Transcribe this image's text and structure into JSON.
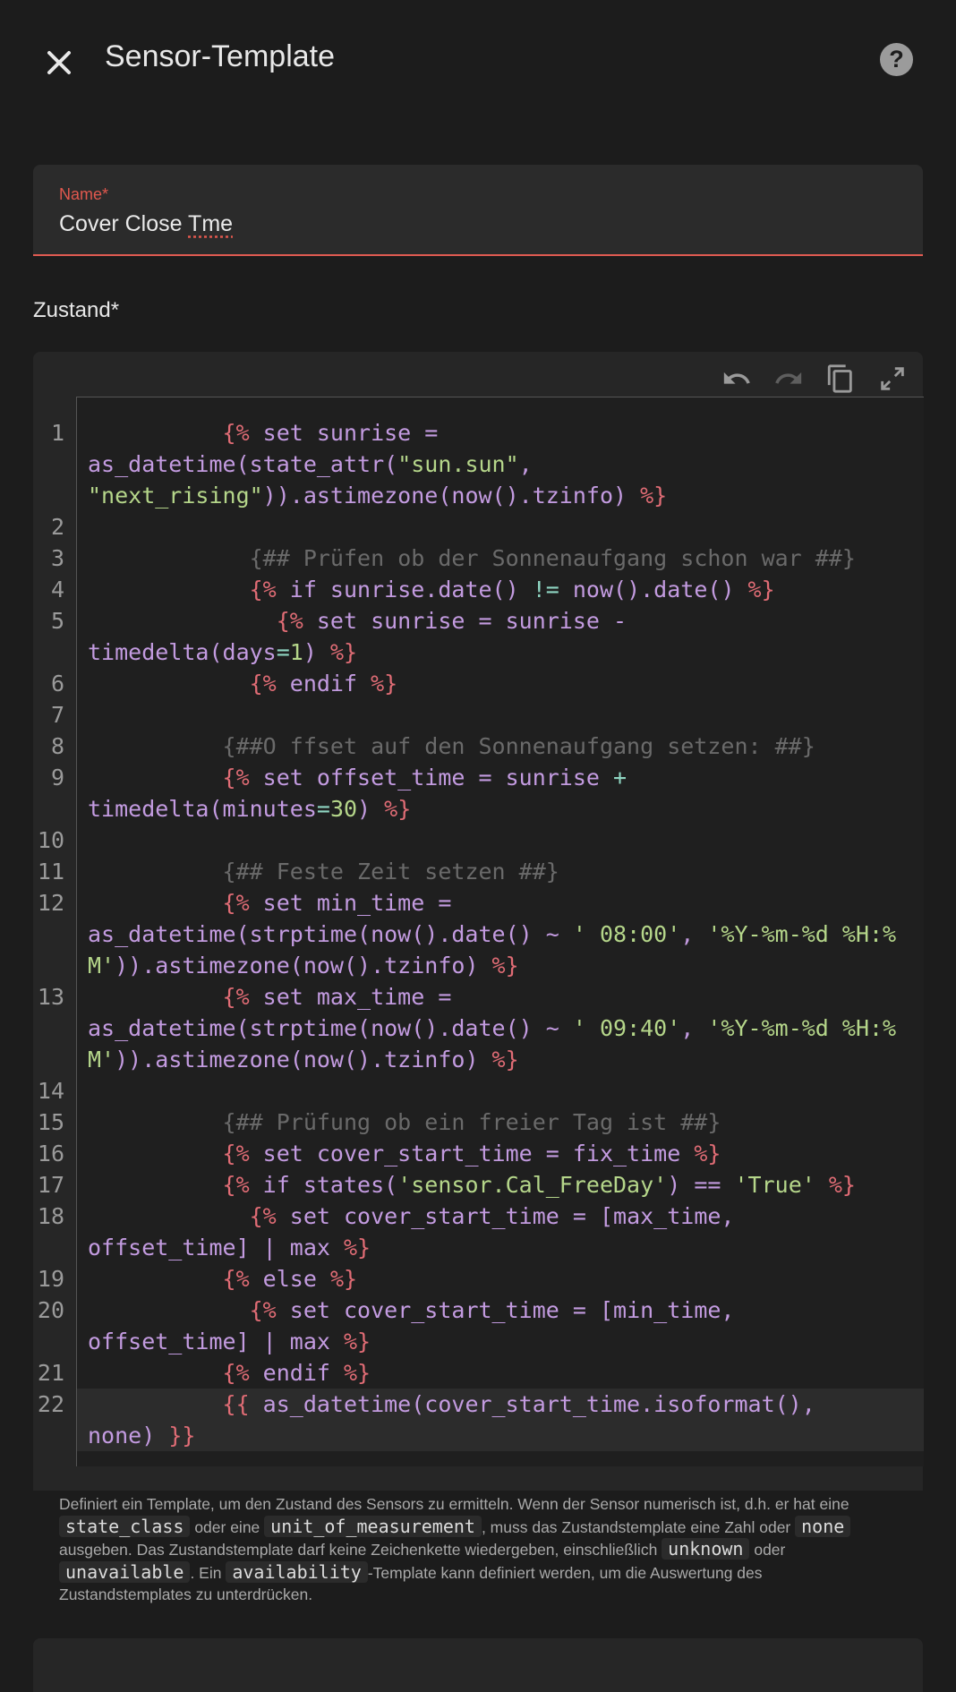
{
  "dialog": {
    "title": "Sensor-Template",
    "close_icon": "close-icon",
    "help_icon": "help-icon",
    "help_glyph": "?"
  },
  "name_field": {
    "label": "Name*",
    "value_a": "Cover Close ",
    "value_b": "Tme"
  },
  "state_section": {
    "label": "Zustand*"
  },
  "editor_toolbar": {
    "undo_icon": "undo-icon",
    "redo_icon": "redo-icon",
    "copy_icon": "copy-icon",
    "fullscreen_icon": "fullscreen-icon"
  },
  "code_lines": [
    {
      "n": "1"
    },
    {
      "n": "2"
    },
    {
      "n": "3"
    },
    {
      "n": "4"
    },
    {
      "n": "5"
    },
    {
      "n": "6"
    },
    {
      "n": "7"
    },
    {
      "n": "8"
    },
    {
      "n": "9"
    },
    {
      "n": "10"
    },
    {
      "n": "11"
    },
    {
      "n": "12"
    },
    {
      "n": "13"
    },
    {
      "n": "14"
    },
    {
      "n": "15"
    },
    {
      "n": "16"
    },
    {
      "n": "17"
    },
    {
      "n": "18"
    },
    {
      "n": "19"
    },
    {
      "n": "20"
    },
    {
      "n": "21"
    },
    {
      "n": "22"
    }
  ],
  "code": {
    "l1a": "          {% ",
    "l1b": "set sunrise =",
    "l1c": "as_datetime(state_attr(",
    "l1d": "\"sun.sun\"",
    "l1e": ",",
    "l1f": "\"next_rising\"",
    "l1g": ")).astimezone(now().tzinfo) ",
    "l1h": "%}",
    "l3": "            {## Prüfen ob der Sonnenaufgang schon war ##}",
    "l4a": "            {% ",
    "l4b": "if sunrise.date() ",
    "l4c": "!=",
    "l4d": " now().date() ",
    "l4e": "%}",
    "l5a": "              {% ",
    "l5b": "set sunrise = sunrise -",
    "l5c": "timedelta(days",
    "l5d": "=",
    "l5e": "1",
    "l5f": ") ",
    "l5g": "%}",
    "l6a": "            {% ",
    "l6b": "endif ",
    "l6c": "%}",
    "l8": "          {##O ffset auf den Sonnenaufgang setzen: ##}",
    "l9a": "          {% ",
    "l9b": "set offset_time = sunrise ",
    "l9c": "+",
    "l9d": "timedelta(minutes",
    "l9e": "=",
    "l9f": "30",
    "l9g": ") ",
    "l9h": "%}",
    "l11": "          {## Feste Zeit setzen ##}",
    "l12a": "          {% ",
    "l12b": "set min_time =",
    "l12c": "as_datetime(strptime(now().date() ~ ",
    "l12d": "' 08:00'",
    "l12e": ", ",
    "l12f": "'%Y-%m-%d %H:%M'",
    "l12g": ")).astimezone(now().tzinfo) ",
    "l12h": "%}",
    "l13a": "          {% ",
    "l13b": "set max_time =",
    "l13c": "as_datetime(strptime(now().date() ~ ",
    "l13d": "' 09:40'",
    "l13e": ", ",
    "l13f": "'%Y-%m-%d %H:%M'",
    "l13g": ")).astimezone(now().tzinfo) ",
    "l13h": "%}",
    "l15": "          {## Prüfung ob ein freier Tag ist ##}",
    "l16a": "          {% ",
    "l16b": "set cover_start_time = fix_time ",
    "l16c": "%}",
    "l17a": "          {% ",
    "l17b": "if states(",
    "l17c": "'sensor.Cal_FreeDay'",
    "l17d": ") == ",
    "l17e": "'True'",
    "l17f": " %}",
    "l18a": "            {% ",
    "l18b": "set cover_start_time = [max_time,",
    "l18c": "offset_time] | max ",
    "l18d": "%}",
    "l19a": "          {% ",
    "l19b": "else ",
    "l19c": "%}",
    "l20a": "            {% ",
    "l20b": "set cover_start_time = [min_time,",
    "l20c": "offset_time] | max ",
    "l20d": "%}",
    "l21a": "          {% ",
    "l21b": "endif ",
    "l21c": "%}",
    "l22a": "          {{ ",
    "l22b": "as_datetime(cover_start_time.isoformat(),",
    "l22c": "none) ",
    "l22d": "}}"
  },
  "helper": {
    "t1": "Definiert ein Template, um den Zustand des Sensors zu ermitteln. Wenn der Sensor numerisch ist, d.h. er hat eine ",
    "c1": "state_class",
    "t2": " oder eine ",
    "c2": "unit_of_measurement",
    "t3": ", muss das Zustandstemplate eine Zahl oder ",
    "c3": "none",
    "t4": " ausgeben. Das Zustandstemplate darf keine Zeichenkette wiedergeben, einschließlich ",
    "c4": "unknown",
    "t5": " oder ",
    "c5": "unavailable",
    "t6": ". Ein ",
    "c6": "availability",
    "t7": "-Template kann definiert werden, um die Auswertung des Zustandstemplates zu unterdrücken."
  },
  "colors": {
    "background": "#1c1c1c",
    "error_accent": "#e0584e",
    "keyword": "#e06c75",
    "identifier": "#c39be0",
    "string": "#b5d68a",
    "comment": "#6a6a6a"
  }
}
